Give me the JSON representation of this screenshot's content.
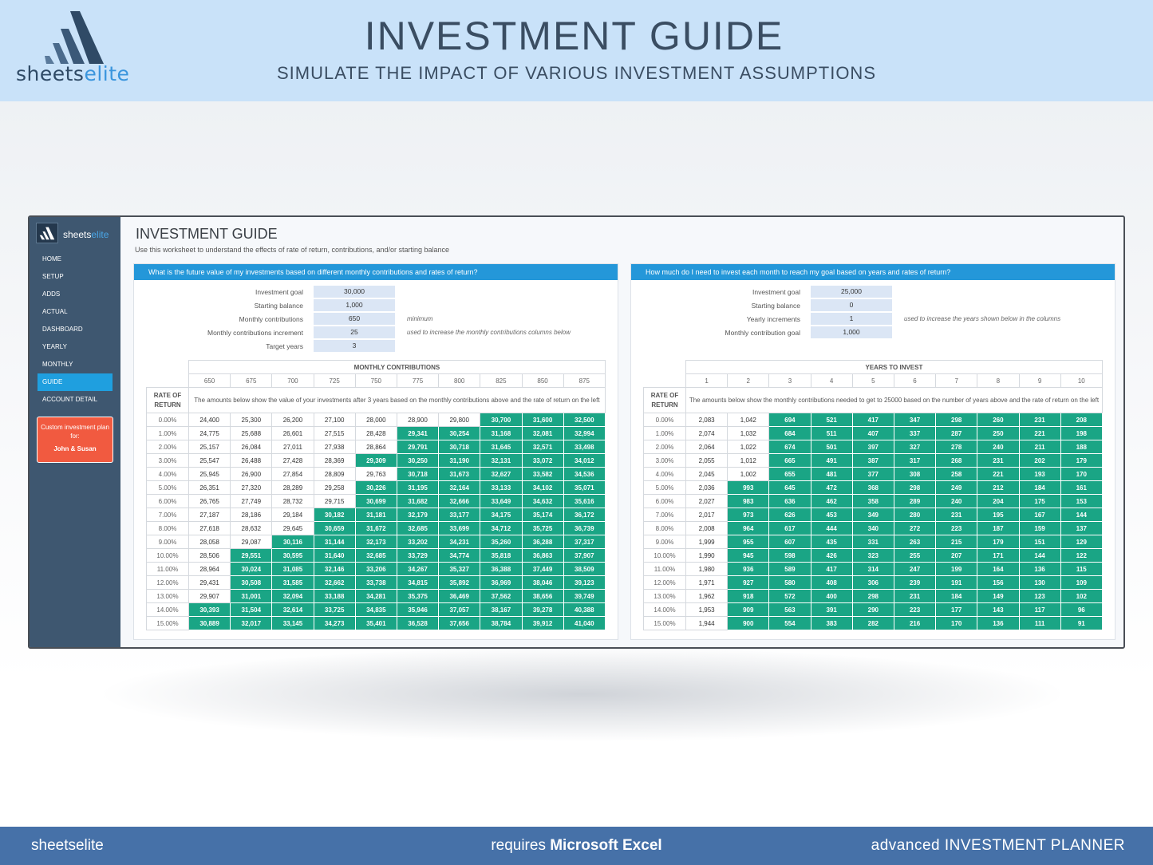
{
  "brand": {
    "name_part1": "sheets",
    "name_part2": "elite"
  },
  "banner": {
    "title": "INVESTMENT GUIDE",
    "subtitle": "SIMULATE THE IMPACT OF VARIOUS INVESTMENT ASSUMPTIONS"
  },
  "sidebar": {
    "items": [
      {
        "label": "HOME"
      },
      {
        "label": "SETUP"
      },
      {
        "label": "ADDS"
      },
      {
        "label": "ACTUAL"
      },
      {
        "label": "DASHBOARD"
      },
      {
        "label": "YEARLY"
      },
      {
        "label": "MONTHLY"
      },
      {
        "label": "GUIDE",
        "active": true
      },
      {
        "label": "ACCOUNT DETAIL"
      }
    ],
    "plan_label": "Custom investment plan for:",
    "plan_name": "John & Susan"
  },
  "main": {
    "title": "INVESTMENT GUIDE",
    "description": "Use this worksheet to understand the effects of rate of return, contributions, and/or starting balance"
  },
  "left_panel": {
    "question": "What is the future value of my investments based on different monthly contributions and rates of return?",
    "inputs": [
      {
        "label": "Investment goal",
        "value": "30,000",
        "note": ""
      },
      {
        "label": "Starting balance",
        "value": "1,000",
        "note": ""
      },
      {
        "label": "Monthly contributions",
        "value": "650",
        "note": "minimum"
      },
      {
        "label": "Monthly contributions increment",
        "value": "25",
        "note": "used to increase the monthly contributions columns below"
      },
      {
        "label": "Target years",
        "value": "3",
        "note": ""
      }
    ],
    "group_header": "MONTHLY CONTRIBUTIONS",
    "rate_label": "RATE OF RETURN",
    "note": "The amounts below show the value of your investments after 3 years based on the monthly contributions above and the rate of return on the left",
    "columns": [
      "650",
      "675",
      "700",
      "725",
      "750",
      "775",
      "800",
      "825",
      "850",
      "875"
    ],
    "rates": [
      "0.00%",
      "1.00%",
      "2.00%",
      "3.00%",
      "4.00%",
      "5.00%",
      "6.00%",
      "7.00%",
      "8.00%",
      "9.00%",
      "10.00%",
      "11.00%",
      "12.00%",
      "13.00%",
      "14.00%",
      "15.00%"
    ],
    "rows": [
      [
        "24,400",
        "25,300",
        "26,200",
        "27,100",
        "28,000",
        "28,900",
        "29,800",
        "30,700",
        "31,600",
        "32,500"
      ],
      [
        "24,775",
        "25,688",
        "26,601",
        "27,515",
        "28,428",
        "29,341",
        "30,254",
        "31,168",
        "32,081",
        "32,994"
      ],
      [
        "25,157",
        "26,084",
        "27,011",
        "27,938",
        "28,864",
        "29,791",
        "30,718",
        "31,645",
        "32,571",
        "33,498"
      ],
      [
        "25,547",
        "26,488",
        "27,428",
        "28,369",
        "29,309",
        "30,250",
        "31,190",
        "32,131",
        "33,072",
        "34,012"
      ],
      [
        "25,945",
        "26,900",
        "27,854",
        "28,809",
        "29,763",
        "30,718",
        "31,673",
        "32,627",
        "33,582",
        "34,536"
      ],
      [
        "26,351",
        "27,320",
        "28,289",
        "29,258",
        "30,226",
        "31,195",
        "32,164",
        "33,133",
        "34,102",
        "35,071"
      ],
      [
        "26,765",
        "27,749",
        "28,732",
        "29,715",
        "30,699",
        "31,682",
        "32,666",
        "33,649",
        "34,632",
        "35,616"
      ],
      [
        "27,187",
        "28,186",
        "29,184",
        "30,182",
        "31,181",
        "32,179",
        "33,177",
        "34,175",
        "35,174",
        "36,172"
      ],
      [
        "27,618",
        "28,632",
        "29,645",
        "30,659",
        "31,672",
        "32,685",
        "33,699",
        "34,712",
        "35,725",
        "36,739"
      ],
      [
        "28,058",
        "29,087",
        "30,116",
        "31,144",
        "32,173",
        "33,202",
        "34,231",
        "35,260",
        "36,288",
        "37,317"
      ],
      [
        "28,506",
        "29,551",
        "30,595",
        "31,640",
        "32,685",
        "33,729",
        "34,774",
        "35,818",
        "36,863",
        "37,907"
      ],
      [
        "28,964",
        "30,024",
        "31,085",
        "32,146",
        "33,206",
        "34,267",
        "35,327",
        "36,388",
        "37,449",
        "38,509"
      ],
      [
        "29,431",
        "30,508",
        "31,585",
        "32,662",
        "33,738",
        "34,815",
        "35,892",
        "36,969",
        "38,046",
        "39,123"
      ],
      [
        "29,907",
        "31,001",
        "32,094",
        "33,188",
        "34,281",
        "35,375",
        "36,469",
        "37,562",
        "38,656",
        "39,749"
      ],
      [
        "30,393",
        "31,504",
        "32,614",
        "33,725",
        "34,835",
        "35,946",
        "37,057",
        "38,167",
        "39,278",
        "40,388"
      ],
      [
        "30,889",
        "32,017",
        "33,145",
        "34,273",
        "35,401",
        "36,528",
        "37,656",
        "38,784",
        "39,912",
        "41,040"
      ]
    ],
    "highlight_start": [
      7,
      5,
      5,
      4,
      5,
      4,
      4,
      3,
      3,
      2,
      1,
      1,
      1,
      1,
      0,
      0
    ]
  },
  "right_panel": {
    "question": "How much do I need to invest each month to reach my goal based on years and rates of return?",
    "inputs": [
      {
        "label": "Investment goal",
        "value": "25,000",
        "note": ""
      },
      {
        "label": "Starting balance",
        "value": "0",
        "note": ""
      },
      {
        "label": "Yearly increments",
        "value": "1",
        "note": "used to increase the years shown below in the columns"
      },
      {
        "label": "Monthly contribution goal",
        "value": "1,000",
        "note": ""
      }
    ],
    "group_header": "YEARS TO INVEST",
    "rate_label": "RATE OF RETURN",
    "note": "The amounts below show the monthly contributions needed to get to 25000 based on the number of years above and the rate of return on the left",
    "columns": [
      "1",
      "2",
      "3",
      "4",
      "5",
      "6",
      "7",
      "8",
      "9",
      "10"
    ],
    "rates": [
      "0.00%",
      "1.00%",
      "2.00%",
      "3.00%",
      "4.00%",
      "5.00%",
      "6.00%",
      "7.00%",
      "8.00%",
      "9.00%",
      "10.00%",
      "11.00%",
      "12.00%",
      "13.00%",
      "14.00%",
      "15.00%"
    ],
    "rows": [
      [
        "2,083",
        "1,042",
        "694",
        "521",
        "417",
        "347",
        "298",
        "260",
        "231",
        "208"
      ],
      [
        "2,074",
        "1,032",
        "684",
        "511",
        "407",
        "337",
        "287",
        "250",
        "221",
        "198"
      ],
      [
        "2,064",
        "1,022",
        "674",
        "501",
        "397",
        "327",
        "278",
        "240",
        "211",
        "188"
      ],
      [
        "2,055",
        "1,012",
        "665",
        "491",
        "387",
        "317",
        "268",
        "231",
        "202",
        "179"
      ],
      [
        "2,045",
        "1,002",
        "655",
        "481",
        "377",
        "308",
        "258",
        "221",
        "193",
        "170"
      ],
      [
        "2,036",
        "993",
        "645",
        "472",
        "368",
        "298",
        "249",
        "212",
        "184",
        "161"
      ],
      [
        "2,027",
        "983",
        "636",
        "462",
        "358",
        "289",
        "240",
        "204",
        "175",
        "153"
      ],
      [
        "2,017",
        "973",
        "626",
        "453",
        "349",
        "280",
        "231",
        "195",
        "167",
        "144"
      ],
      [
        "2,008",
        "964",
        "617",
        "444",
        "340",
        "272",
        "223",
        "187",
        "159",
        "137"
      ],
      [
        "1,999",
        "955",
        "607",
        "435",
        "331",
        "263",
        "215",
        "179",
        "151",
        "129"
      ],
      [
        "1,990",
        "945",
        "598",
        "426",
        "323",
        "255",
        "207",
        "171",
        "144",
        "122"
      ],
      [
        "1,980",
        "936",
        "589",
        "417",
        "314",
        "247",
        "199",
        "164",
        "136",
        "115"
      ],
      [
        "1,971",
        "927",
        "580",
        "408",
        "306",
        "239",
        "191",
        "156",
        "130",
        "109"
      ],
      [
        "1,962",
        "918",
        "572",
        "400",
        "298",
        "231",
        "184",
        "149",
        "123",
        "102"
      ],
      [
        "1,953",
        "909",
        "563",
        "391",
        "290",
        "223",
        "177",
        "143",
        "117",
        "96"
      ],
      [
        "1,944",
        "900",
        "554",
        "383",
        "282",
        "216",
        "170",
        "136",
        "111",
        "91"
      ]
    ],
    "highlight_start": [
      2,
      2,
      2,
      2,
      2,
      1,
      1,
      1,
      1,
      1,
      1,
      1,
      1,
      1,
      1,
      1
    ]
  },
  "footer": {
    "left": "sheetselite",
    "center_prefix": "requires ",
    "center_bold": "Microsoft Excel",
    "right": "advanced INVESTMENT PLANNER"
  },
  "colors": {
    "banner_bg": "#c9e2f9",
    "sidebar_bg": "#3e5770",
    "panel_header": "#2497d9",
    "highlight_cell": "#1aa585",
    "plan_box": "#f15a40",
    "footer_bg": "#4671a8"
  }
}
